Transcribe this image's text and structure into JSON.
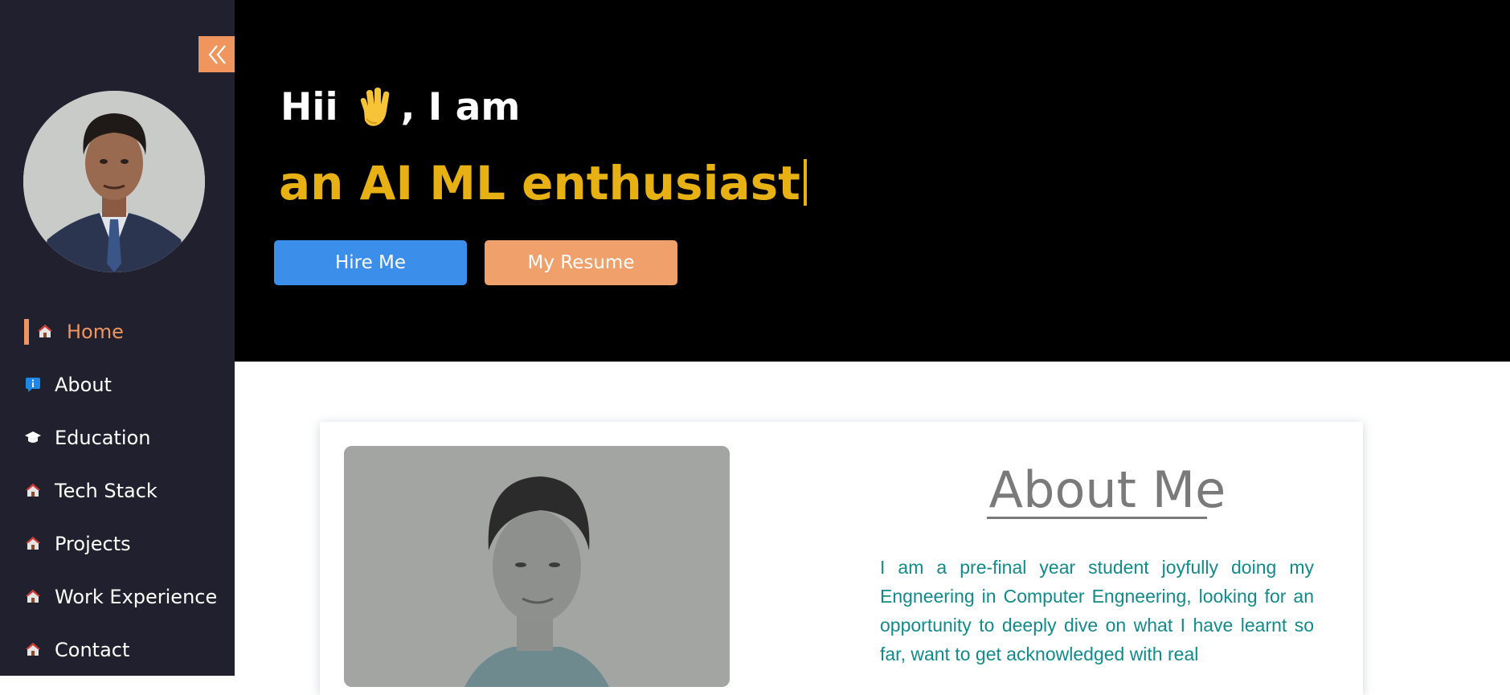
{
  "sidebar": {
    "collapse_icon": "double-chevron-left-icon",
    "nav": [
      {
        "label": "Home",
        "icon": "house-icon",
        "active": true
      },
      {
        "label": "About",
        "icon": "info-icon"
      },
      {
        "label": "Education",
        "icon": "graduation-cap-icon"
      },
      {
        "label": "Tech Stack",
        "icon": "house-icon"
      },
      {
        "label": "Projects",
        "icon": "house-icon"
      },
      {
        "label": "Work Experience",
        "icon": "house-icon"
      },
      {
        "label": "Contact",
        "icon": "house-icon"
      }
    ]
  },
  "hero": {
    "greeting_prefix": "Hii",
    "greeting_suffix": ", I am",
    "typed_text": "an AI ML enthusiast",
    "hire_label": "Hire Me",
    "resume_label": "My Resume"
  },
  "about": {
    "title": "About Me",
    "text": "I am a pre-final year student joyfully doing my Engneering in Computer Engneering, looking for an opportunity to deeply dive on what I have learnt so far, want to get acknowledged with real"
  },
  "colors": {
    "sidebar_bg": "#20202e",
    "accent_orange": "#f0955e",
    "typed_gold": "#e7b114",
    "hire_blue": "#3b8eea",
    "about_text_teal": "#138a8a"
  }
}
